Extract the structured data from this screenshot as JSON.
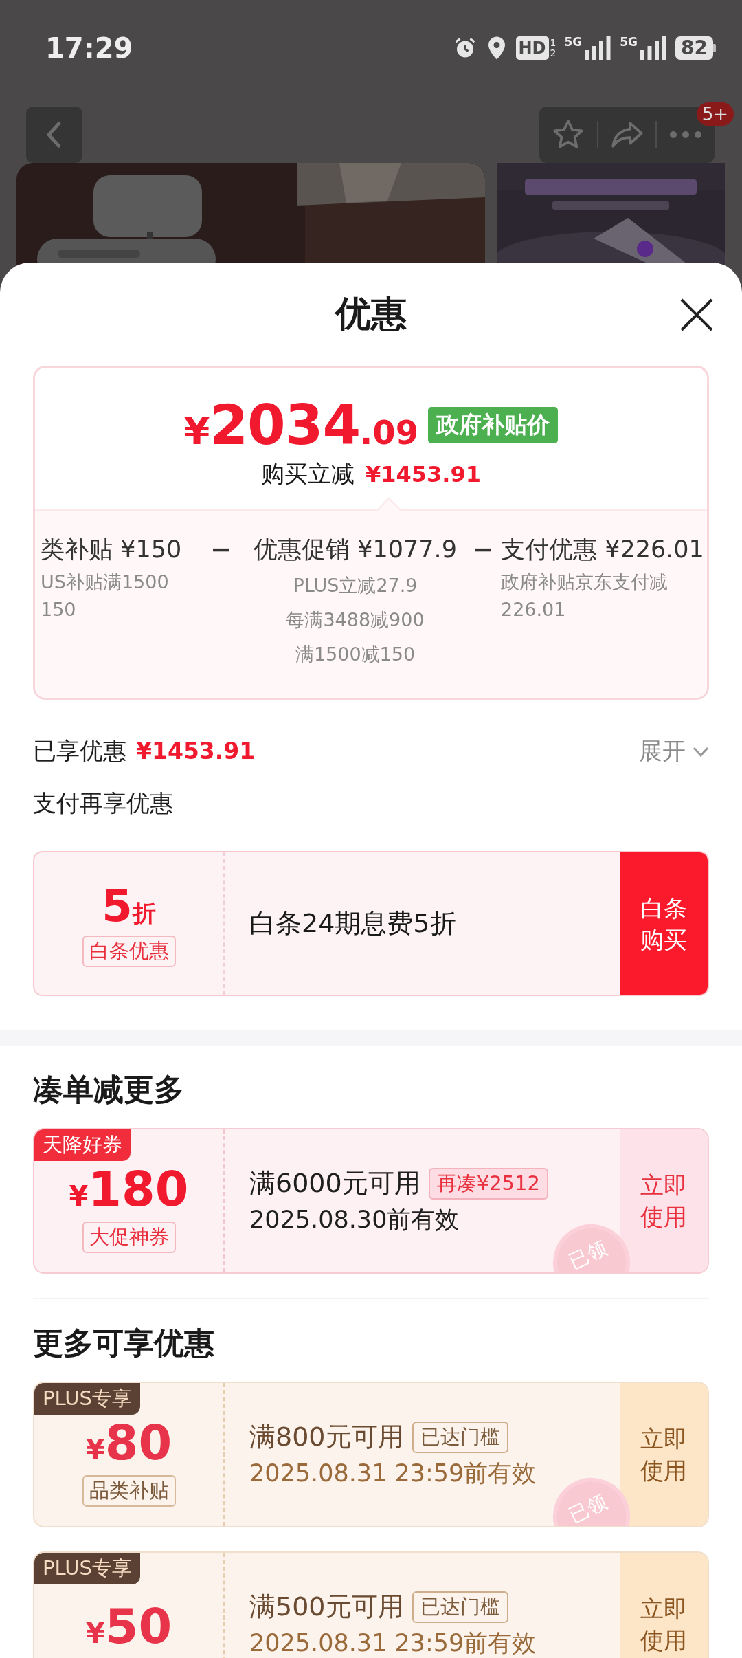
{
  "status_bar": {
    "time": "17:29",
    "hd": {
      "label": "HD",
      "slots": [
        "1",
        "2"
      ]
    },
    "networks": [
      "5G",
      "5G"
    ],
    "battery": "82"
  },
  "nav": {
    "more_badge": "5+"
  },
  "header": {
    "title": "优惠"
  },
  "price_card": {
    "price": "¥2034.09",
    "price_tag": "政府补贴价",
    "reduction_label": "购买立减",
    "reduction_amount": "¥1453.91",
    "breakdown": [
      {
        "kind": "item",
        "title": "类补贴 ¥150",
        "lines": [
          "US补贴满1500",
          "150"
        ]
      },
      {
        "kind": "separator",
        "text": "−"
      },
      {
        "kind": "item",
        "title": "优惠促销 ¥1077.9",
        "lines": [
          "PLUS立减27.9",
          "每满3488减900",
          "满1500减150"
        ]
      },
      {
        "kind": "separator",
        "text": "−"
      },
      {
        "kind": "item",
        "title": "支付优惠 ¥226.01",
        "lines": [
          "政府补贴京东支付减",
          "226.01"
        ]
      }
    ]
  },
  "enjoyed": {
    "label": "已享优惠",
    "amount": "¥1453.91",
    "toggle": "展开",
    "expanded": false
  },
  "pay_section": {
    "title": "支付再享优惠",
    "offer": {
      "value": "5折",
      "tag": "白条优惠",
      "description": "白条24期息费5折",
      "button": "白条购买"
    }
  },
  "sections": [
    {
      "title": "凑单减更多",
      "coupons": [
        {
          "kind": "promo",
          "ribbon": "天降好券",
          "amount": "¥180",
          "tag": "大促神券",
          "condition": "满6000元可用",
          "badge": "再凑¥2512",
          "validity": "2025.08.30前有效",
          "button": "立即使用",
          "stamp": "已领"
        }
      ]
    },
    {
      "title": "更多可享优惠",
      "coupons": [
        {
          "kind": "plus",
          "ribbon": "PLUS专享",
          "amount": "¥80",
          "tag": "品类补贴",
          "condition": "满800元可用",
          "badge": "已达门槛",
          "validity": "2025.08.31 23:59前有效",
          "button": "立即使用",
          "stamp": "已领"
        },
        {
          "kind": "plus",
          "ribbon": "PLUS专享",
          "amount": "¥50",
          "condition": "满500元可用",
          "badge": "已达门槛",
          "validity": "2025.08.31 23:59前有效",
          "button": "立即使用"
        }
      ]
    }
  ]
}
